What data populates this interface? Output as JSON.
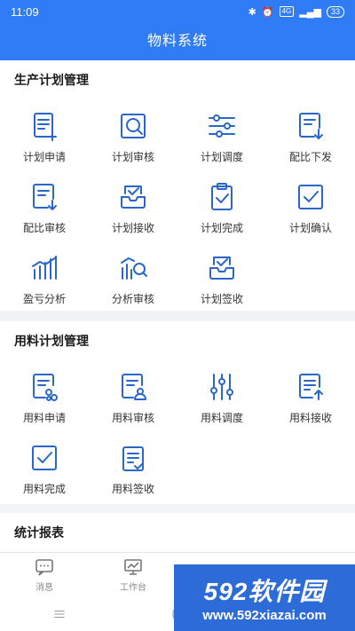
{
  "status": {
    "time": "11:09",
    "net": "4G",
    "battery": "33"
  },
  "header": {
    "title": "物料系统"
  },
  "sections": [
    {
      "title": "生产计划管理",
      "items": [
        {
          "label": "计划申请",
          "icon": "doc-plus-icon"
        },
        {
          "label": "计划审核",
          "icon": "magnify-doc-icon"
        },
        {
          "label": "计划调度",
          "icon": "sliders-icon"
        },
        {
          "label": "配比下发",
          "icon": "doc-download-icon"
        },
        {
          "label": "配比审核",
          "icon": "doc-download-icon"
        },
        {
          "label": "计划接收",
          "icon": "inbox-check-icon"
        },
        {
          "label": "计划完成",
          "icon": "clipboard-check-icon"
        },
        {
          "label": "计划确认",
          "icon": "checkbox-icon"
        },
        {
          "label": "盈亏分析",
          "icon": "bar-chart-icon"
        },
        {
          "label": "分析审核",
          "icon": "chart-search-icon"
        },
        {
          "label": "计划签收",
          "icon": "inbox-check-icon"
        }
      ]
    },
    {
      "title": "用料计划管理",
      "items": [
        {
          "label": "用料申请",
          "icon": "doc-apply-icon"
        },
        {
          "label": "用料审核",
          "icon": "doc-user-icon"
        },
        {
          "label": "用料调度",
          "icon": "sliders-vertical-icon"
        },
        {
          "label": "用料接收",
          "icon": "doc-upload-icon"
        },
        {
          "label": "用料完成",
          "icon": "checkbox-icon"
        },
        {
          "label": "用料签收",
          "icon": "doc-sign-icon"
        }
      ]
    },
    {
      "title": "统计报表",
      "items": []
    }
  ],
  "tabs": [
    {
      "label": "消息",
      "icon": "message-icon"
    },
    {
      "label": "工作台",
      "icon": "workbench-icon"
    },
    {
      "label": "",
      "icon": "layers-icon"
    },
    {
      "label": "",
      "icon": "search-user-icon"
    }
  ],
  "watermark": {
    "title": "592软件园",
    "url": "www.592xiazai.com"
  },
  "colors": {
    "primary": "#2f7cf6",
    "icon": "#2b67c9"
  }
}
